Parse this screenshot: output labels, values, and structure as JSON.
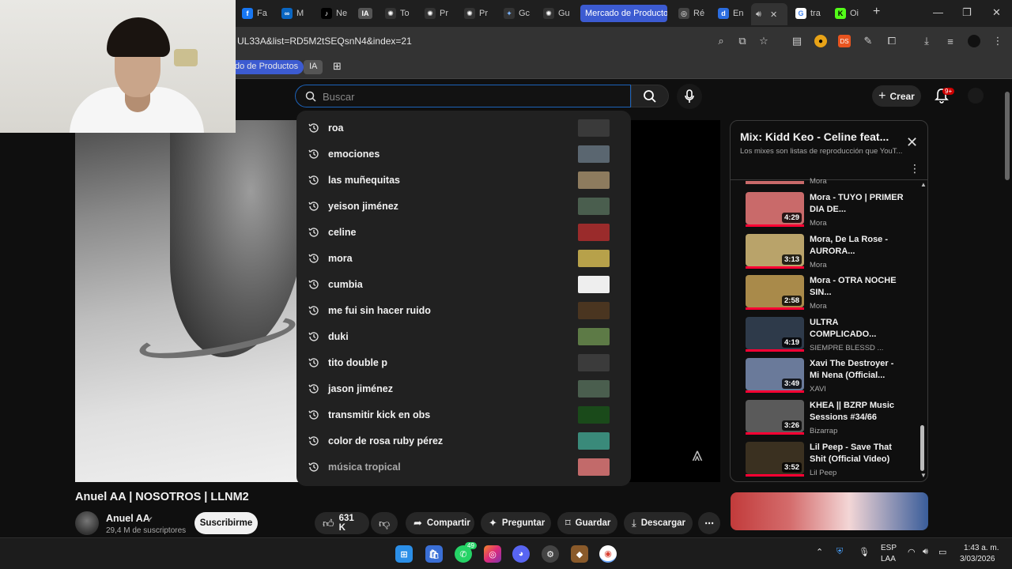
{
  "browser": {
    "tabs": [
      {
        "label": "Fa",
        "icon": "facebook-icon",
        "color": "#1877f2",
        "glyph": "f"
      },
      {
        "label": "M",
        "icon": "meta-icon",
        "color": "#0a66c2",
        "glyph": "∞"
      },
      {
        "label": "Ne",
        "icon": "tiktok-icon",
        "color": "#000000",
        "glyph": "♪"
      },
      {
        "label": "IA",
        "icon": "ia-icon",
        "color": "#555555",
        "glyph": "IA"
      },
      {
        "label": "To",
        "icon": "chatgpt-icon",
        "color": "#333333",
        "glyph": "✺"
      },
      {
        "label": "Pr",
        "icon": "chatgpt-icon",
        "color": "#333333",
        "glyph": "✺"
      },
      {
        "label": "Pr",
        "icon": "chatgpt-icon",
        "color": "#333333",
        "glyph": "✺"
      },
      {
        "label": "Gc",
        "icon": "gemini-icon",
        "color": "#333333",
        "glyph": "✦"
      },
      {
        "label": "Gu",
        "icon": "chatgpt-icon",
        "color": "#333333",
        "glyph": "✺"
      }
    ],
    "tab_group_label": "Mercado de Productos",
    "tabs_after": [
      {
        "label": "Ré",
        "icon": "perplexity-icon",
        "color": "#444444",
        "glyph": "◎"
      },
      {
        "label": "En",
        "icon": "d-icon",
        "color": "#2b6de0",
        "glyph": "d"
      }
    ],
    "active_tab_icon": "speaker-icon",
    "tabs_last": [
      {
        "label": "tra",
        "icon": "google-icon",
        "color": "#ffffff",
        "glyph": "G"
      },
      {
        "label": "Oi",
        "icon": "kick-icon",
        "color": "#53fc18",
        "glyph": "K"
      }
    ],
    "url": "UL33A&list=RD5M2tSEQsnN4&index=21",
    "bookmarks": [
      "do de Productos",
      "IA"
    ],
    "accent_color": "#3c5bd1"
  },
  "youtube": {
    "search_placeholder": "Buscar",
    "crear_label": "Crear",
    "notif_badge": "9+",
    "suggestions": [
      {
        "text": "roa",
        "thumb": "#3a3a3a"
      },
      {
        "text": "emociones",
        "thumb": "#5a6670"
      },
      {
        "text": "las muñequitas",
        "thumb": "#8d7b5e"
      },
      {
        "text": "yeison jiménez",
        "thumb": "#4a5e4e"
      },
      {
        "text": "celine",
        "thumb": "#9a2b2b"
      },
      {
        "text": "mora",
        "thumb": "#b7a14a"
      },
      {
        "text": "cumbia",
        "thumb": "#eeeeee"
      },
      {
        "text": "me fui sin hacer ruido",
        "thumb": "#4a3520"
      },
      {
        "text": "duki",
        "thumb": "#5d7a46"
      },
      {
        "text": "tito double p",
        "thumb": "#3b3b3b"
      },
      {
        "text": "jason jiménez",
        "thumb": "#4a5e4e"
      },
      {
        "text": "transmitir kick en obs",
        "thumb": "#1a4a1a"
      },
      {
        "text": "color de rosa ruby pérez",
        "thumb": "#3a8a7a"
      },
      {
        "text": "música tropical",
        "thumb": "#c26a6a"
      }
    ],
    "video_title": "Anuel AA | NOSOTROS | LLNM2",
    "channel_name": "Anuel AA",
    "subscribers": "29,4 M de suscriptores",
    "subscribe_label": "Suscribirme",
    "likes": "631 K",
    "actions": {
      "share": "Compartir",
      "ask": "Preguntar",
      "save": "Guardar",
      "download": "Descargar"
    },
    "playlist": {
      "title": "Mix: Kidd Keo - Celine feat...",
      "subtitle": "Los mixes son listas de reproducción que YouT...",
      "top_partial_channel": "Mora",
      "items": [
        {
          "title": "Mora - TUYO | PRIMER DIA DE...",
          "channel": "Mora",
          "duration": "4:29",
          "thumb": "#c96a6a"
        },
        {
          "title": "Mora, De La Rose - AURORA...",
          "channel": "Mora",
          "duration": "3:13",
          "thumb": "#b9a36a"
        },
        {
          "title": "Mora - OTRA NOCHE SIN...",
          "channel": "Mora",
          "duration": "2:58",
          "thumb": "#a98a4a"
        },
        {
          "title": "ULTRA COMPLICADO...",
          "channel": "SIEMPRE BLESSD ...",
          "duration": "4:19",
          "thumb": "#2e3a4a"
        },
        {
          "title": "Xavi The Destroyer - Mi Nena (Official...",
          "channel": "XAVI",
          "duration": "3:49",
          "thumb": "#6a7a9a"
        },
        {
          "title": "KHEA || BZRP Music Sessions #34/66",
          "channel": "Bizarrap",
          "duration": "3:26",
          "thumb": "#5a5a5a"
        },
        {
          "title": "Lil Peep - Save That Shit (Official Video)",
          "channel": "Lil Peep",
          "duration": "3:52",
          "thumb": "#3a3020"
        }
      ]
    }
  },
  "taskbar": {
    "lang": "ESP",
    "lang_sub": "LAA",
    "time": "1:43 a. m.",
    "date": "3/03/2026",
    "whatsapp_badge": "49"
  }
}
